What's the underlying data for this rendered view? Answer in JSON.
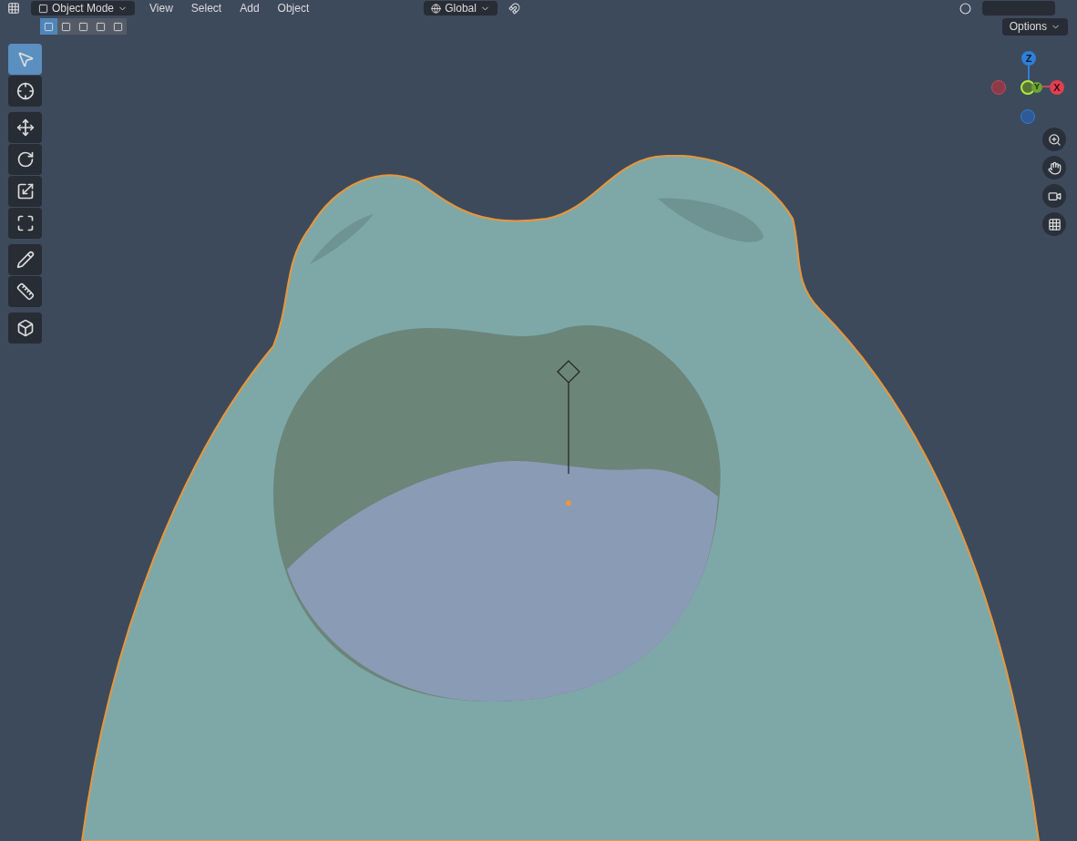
{
  "header": {
    "mode": "Object Mode",
    "menus": [
      "View",
      "Select",
      "Add",
      "Object"
    ],
    "orientation": "Global"
  },
  "select_modes": [
    {
      "selected": true
    },
    {
      "selected": false
    },
    {
      "selected": false
    },
    {
      "selected": false
    },
    {
      "selected": false
    }
  ],
  "options": "Options",
  "toolbar": [
    {
      "kind": "select",
      "selected": true
    },
    {
      "kind": "cursor",
      "selected": false
    },
    {
      "kind": "move",
      "selected": false
    },
    {
      "kind": "rotate",
      "selected": false
    },
    {
      "kind": "scale",
      "selected": false
    },
    {
      "kind": "transform",
      "selected": false
    },
    {
      "kind": "annotate",
      "selected": false
    },
    {
      "kind": "measure",
      "selected": false
    },
    {
      "kind": "add",
      "selected": false
    }
  ],
  "gizmo": {
    "z": "Z",
    "y": "Y",
    "x": "X"
  },
  "nav": [
    {
      "kind": "zoom"
    },
    {
      "kind": "pan"
    },
    {
      "kind": "camera"
    },
    {
      "kind": "ortho"
    }
  ]
}
